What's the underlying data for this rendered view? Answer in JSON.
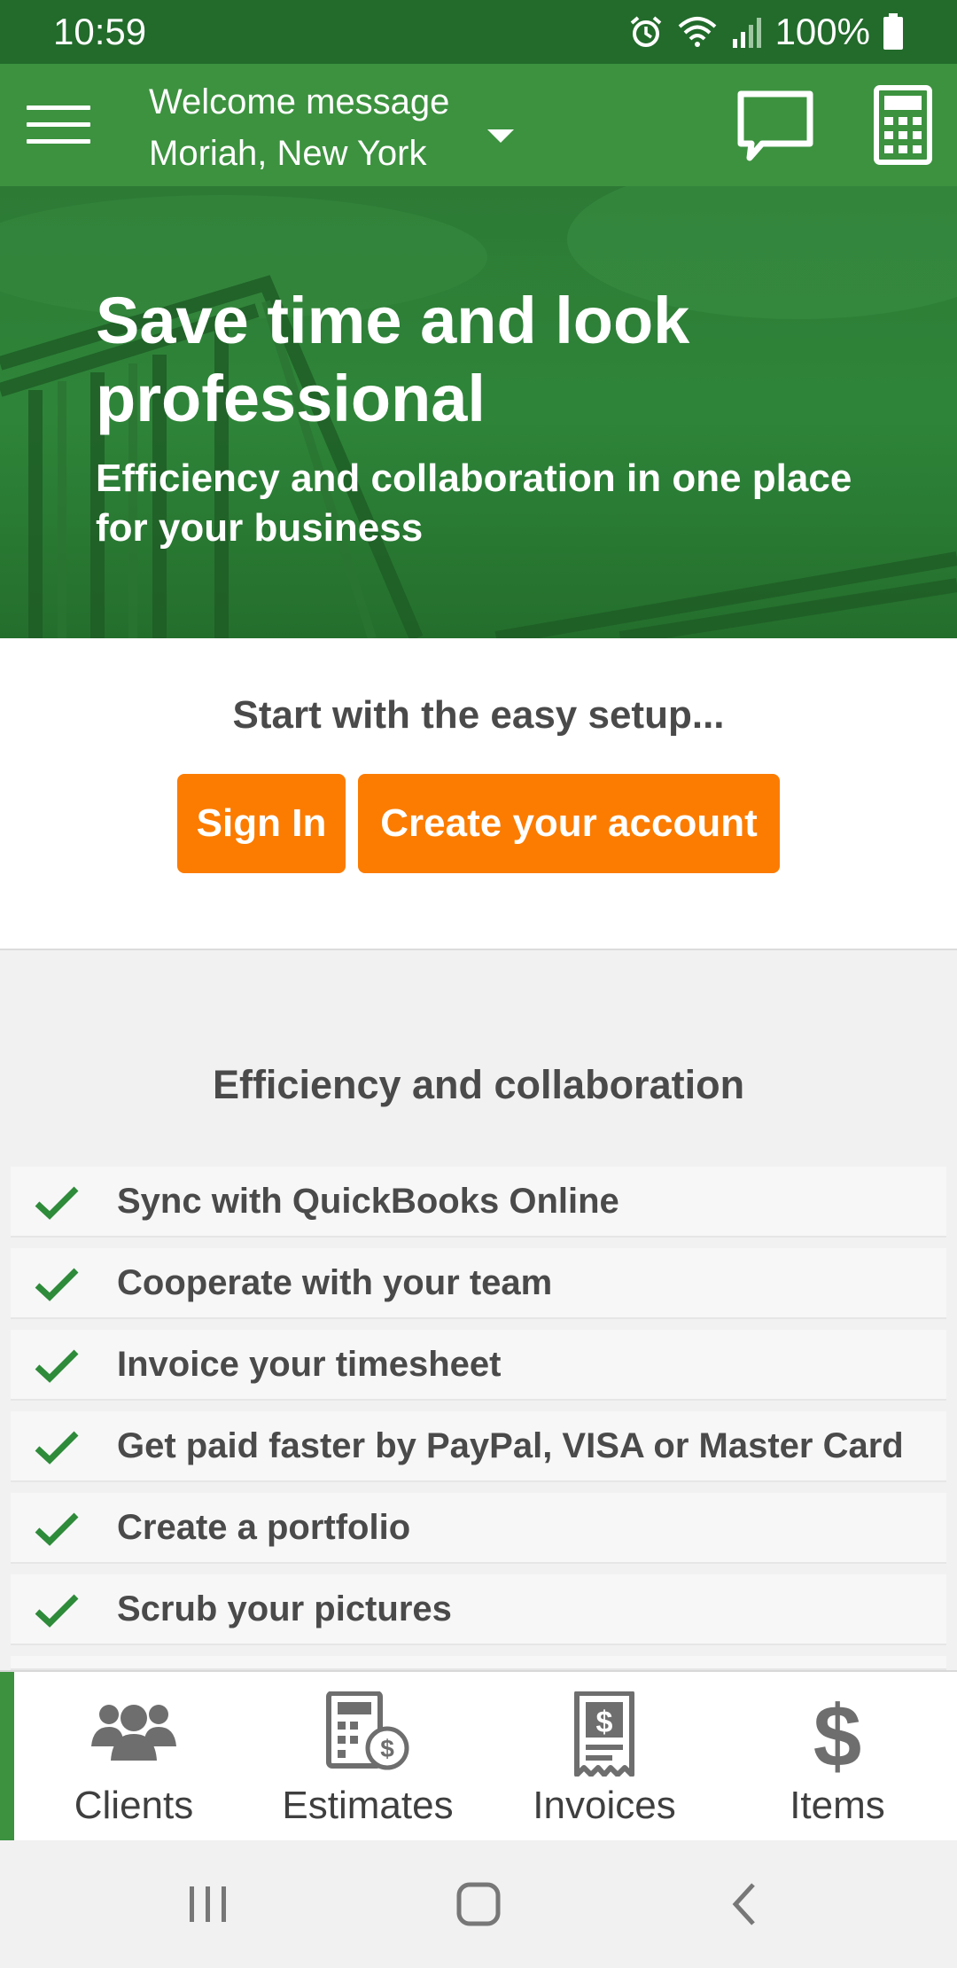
{
  "status_bar": {
    "time": "10:59",
    "battery": "100%"
  },
  "app_bar": {
    "location_title": "Welcome message",
    "location_subtitle": "Moriah, New York"
  },
  "hero": {
    "title": "Save time and look professional",
    "subtitle": "Efficiency and collaboration in one place for your business"
  },
  "setup": {
    "prompt": "Start with the easy setup...",
    "sign_in_label": "Sign In",
    "create_account_label": "Create your account"
  },
  "features": {
    "title": "Efficiency and collaboration",
    "items": [
      "Sync with QuickBooks Online",
      "Cooperate with your team",
      "Invoice your timesheet",
      "Get paid faster by PayPal, VISA or Master Card",
      "Create a portfolio",
      "Scrub your pictures"
    ]
  },
  "bottom_nav": {
    "items": [
      {
        "label": "Clients",
        "icon": "clients-icon"
      },
      {
        "label": "Estimates",
        "icon": "estimates-icon"
      },
      {
        "label": "Invoices",
        "icon": "invoices-icon"
      },
      {
        "label": "Items",
        "icon": "dollar-icon"
      }
    ]
  },
  "colors": {
    "primary_green": "#3c923f",
    "status_green": "#226b2b",
    "accent_orange": "#fb7c00",
    "check_green": "#2e8b3a"
  }
}
